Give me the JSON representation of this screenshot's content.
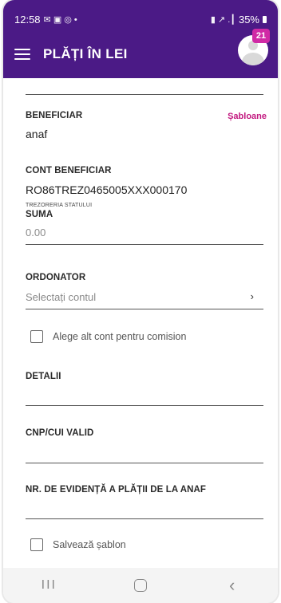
{
  "statusbar": {
    "time": "12:58",
    "left_icons": "✉ ▣ ◎ •",
    "battery": "35%",
    "right_icons": "▮ ↗ .┃"
  },
  "appbar": {
    "title": "PLĂȚI ÎN LEI",
    "badge": "21"
  },
  "form": {
    "beneficiar_label": "BENEFICIAR",
    "templates_link": "Șabloane",
    "beneficiar_value": "anaf",
    "cont_label": "CONT BENEFICIAR",
    "cont_value": "RO86TREZ0465005XXX000170",
    "cont_note": "TREZORERIA STATULUI",
    "suma_label": "SUMA",
    "suma_placeholder": "0.00",
    "ordonator_label": "ORDONATOR",
    "ordonator_placeholder": "Selectați contul",
    "ordonator_chevron": "›",
    "commission_checkbox_label": "Alege alt cont pentru comision",
    "detalii_label": "DETALII",
    "cnp_label": "CNP/CUI VALID",
    "nr_label": "NR. DE EVIDENȚĂ A PLĂȚII DE LA ANAF",
    "save_template_label": "Salvează șablon"
  },
  "navbar": {
    "recents": "III",
    "back": "‹"
  }
}
